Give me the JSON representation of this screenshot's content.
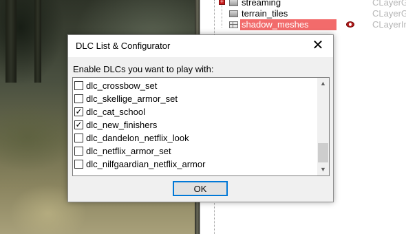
{
  "scene_tree": {
    "rows": [
      {
        "label": "streaming",
        "class": "CLayerGr"
      },
      {
        "label": "terrain_tiles",
        "class": "CLayerGr"
      },
      {
        "label": "shadow_meshes",
        "class": "CLayerInf"
      }
    ]
  },
  "dialog": {
    "title": "DLC List & Configurator",
    "close_glyph": "✕",
    "prompt": "Enable DLCs you want to play with:",
    "items": [
      {
        "label": "dlc_crossbow_set",
        "checked": false
      },
      {
        "label": "dlc_skellige_armor_set",
        "checked": false
      },
      {
        "label": "dlc_cat_school",
        "checked": true
      },
      {
        "label": "dlc_new_finishers",
        "checked": true
      },
      {
        "label": "dlc_dandelon_netflix_look",
        "checked": false
      },
      {
        "label": "dlc_netflix_armor_set",
        "checked": false
      },
      {
        "label": "dlc_nilfgaardian_netflix_armor",
        "checked": false
      }
    ],
    "scroll_up_glyph": "▲",
    "scroll_down_glyph": "▼",
    "ok_label": "OK"
  },
  "colors": {
    "selection": "#f26b6b",
    "focus_border": "#0078d7",
    "dialog_bg": "#f0f0f0"
  }
}
